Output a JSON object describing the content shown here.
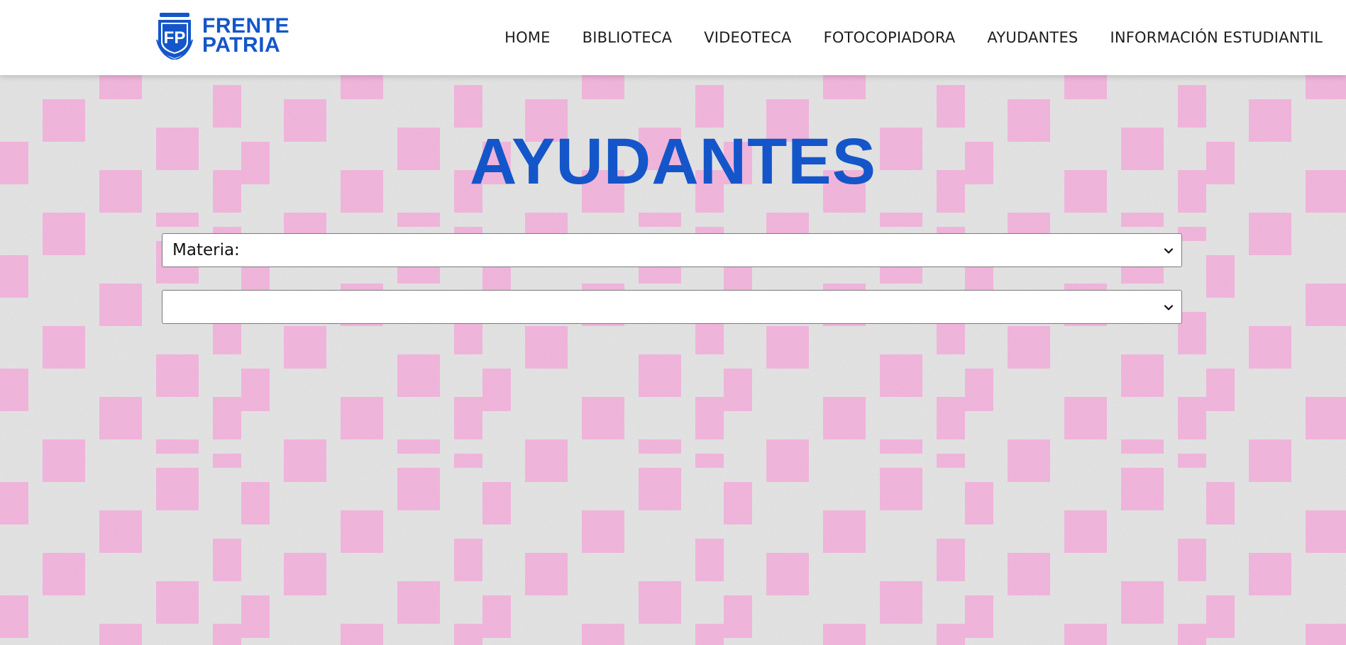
{
  "brand": {
    "line1": "FRENTE",
    "line2": "PATRIA",
    "logo_icon": "frente-patria-shield-logo",
    "color": "#1456c9"
  },
  "nav": {
    "items": [
      {
        "label": "HOME"
      },
      {
        "label": "BIBLIOTECA"
      },
      {
        "label": "VIDEOTECA"
      },
      {
        "label": "FOTOCOPIADORA"
      },
      {
        "label": "AYUDANTES"
      },
      {
        "label": "INFORMACIÓN ESTUDIANTIL"
      }
    ]
  },
  "main": {
    "title": "AYUDANTES",
    "filters": {
      "materia": {
        "value": "Materia:",
        "icon": "chevron-down-icon"
      },
      "second": {
        "value": "",
        "icon": "chevron-down-icon"
      }
    }
  },
  "colors": {
    "accent": "#1456c9",
    "pattern_pink": "#f4b3dd",
    "pattern_gray": "#e3e3e3"
  }
}
